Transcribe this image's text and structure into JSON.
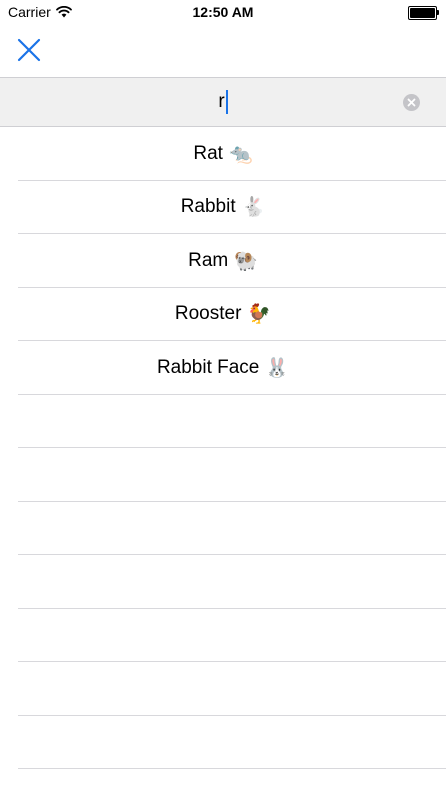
{
  "status_bar": {
    "carrier": "Carrier",
    "time": "12:50 AM",
    "wifi_icon": "wifi-icon",
    "battery_icon": "battery-icon"
  },
  "nav": {
    "close_icon": "close-icon",
    "accent_color": "#1a73e8"
  },
  "search": {
    "value": "r",
    "clear_icon": "clear-icon"
  },
  "results": [
    {
      "label": "Rat",
      "emoji": "🐀"
    },
    {
      "label": "Rabbit",
      "emoji": "🐇"
    },
    {
      "label": "Ram",
      "emoji": "🐏"
    },
    {
      "label": "Rooster",
      "emoji": "🐓"
    },
    {
      "label": "Rabbit Face",
      "emoji": "🐰"
    },
    {
      "label": "",
      "emoji": ""
    },
    {
      "label": "",
      "emoji": ""
    },
    {
      "label": "",
      "emoji": ""
    },
    {
      "label": "",
      "emoji": ""
    },
    {
      "label": "",
      "emoji": ""
    },
    {
      "label": "",
      "emoji": ""
    },
    {
      "label": "",
      "emoji": ""
    }
  ]
}
